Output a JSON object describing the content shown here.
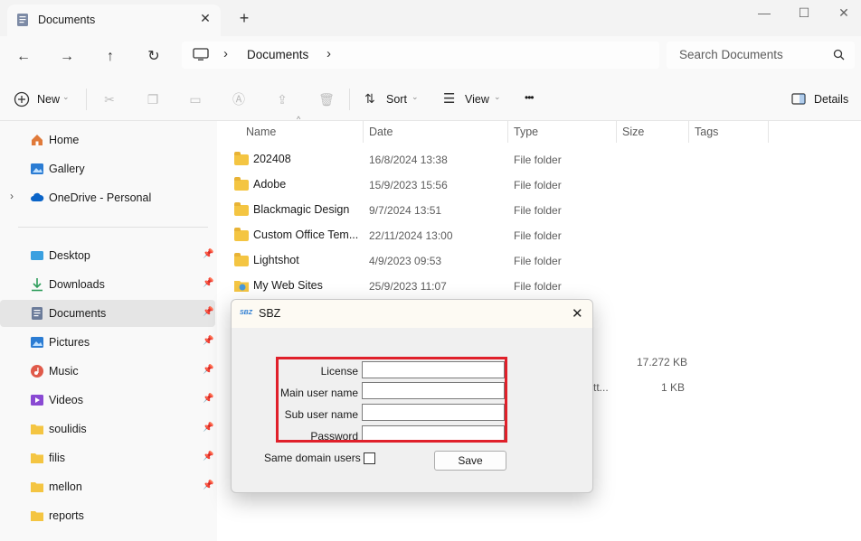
{
  "window": {
    "tab_title": "Documents",
    "tab_close": "✕",
    "new_tab": "+",
    "minimize": "—",
    "maximize": "☐",
    "close": "✕"
  },
  "nav": {
    "back": "←",
    "forward": "→",
    "up": "↑",
    "refresh": "↻",
    "breadcrumb": [
      "Documents"
    ],
    "chevron": "›",
    "search_placeholder": "Search Documents"
  },
  "toolbar": {
    "new_label": "New",
    "sort_label": "Sort",
    "view_label": "View",
    "more_label": "•••",
    "details_label": "Details"
  },
  "sidebar": {
    "top": [
      {
        "label": "Home",
        "icon": "home-icon",
        "color": "#e07a3a"
      },
      {
        "label": "Gallery",
        "icon": "gallery-icon",
        "color": "#2b7cd3"
      },
      {
        "label": "OneDrive - Personal",
        "icon": "cloud-icon",
        "color": "#0a64c8"
      }
    ],
    "pinned": [
      {
        "label": "Desktop",
        "icon": "desktop-icon",
        "color": "#3aa0e0"
      },
      {
        "label": "Downloads",
        "icon": "download-icon",
        "color": "#2e9d5b"
      },
      {
        "label": "Documents",
        "icon": "documents-icon",
        "color": "#6b7b99"
      },
      {
        "label": "Pictures",
        "icon": "pictures-icon",
        "color": "#2b7cd3"
      },
      {
        "label": "Music",
        "icon": "music-icon",
        "color": "#e05a4a"
      },
      {
        "label": "Videos",
        "icon": "videos-icon",
        "color": "#8a4ad3"
      },
      {
        "label": "soulidis",
        "icon": "folder-icon",
        "color": "#f4c542"
      },
      {
        "label": "filis",
        "icon": "folder-icon",
        "color": "#f4c542"
      },
      {
        "label": "mellon",
        "icon": "folder-icon",
        "color": "#f4c542"
      },
      {
        "label": "reports",
        "icon": "folder-icon",
        "color": "#f4c542"
      }
    ]
  },
  "columns": [
    "Name",
    "Date",
    "Type",
    "Size",
    "Tags"
  ],
  "files": [
    {
      "name": "202408",
      "date": "16/8/2024 13:38",
      "type": "File folder",
      "size": ""
    },
    {
      "name": "Adobe",
      "date": "15/9/2023 15:56",
      "type": "File folder",
      "size": ""
    },
    {
      "name": "Blackmagic Design",
      "date": "9/7/2024 13:51",
      "type": "File folder",
      "size": ""
    },
    {
      "name": "Custom Office Tem...",
      "date": "22/11/2024 13:00",
      "type": "File folder",
      "size": ""
    },
    {
      "name": "Lightshot",
      "date": "4/9/2023 09:53",
      "type": "File folder",
      "size": ""
    },
    {
      "name": "My Web Sites",
      "date": "25/9/2023 11:07",
      "type": "File folder",
      "size": ""
    }
  ],
  "hidden_rows": [
    {
      "type_partial": "",
      "size": "17.272 KB"
    },
    {
      "type_partial": "tt...",
      "size": "1 KB"
    }
  ],
  "dialog": {
    "logo": "SBZ",
    "title": "SBZ",
    "close": "✕",
    "fields": [
      {
        "label": "License",
        "value": ""
      },
      {
        "label": "Main user name",
        "value": ""
      },
      {
        "label": "Sub user name",
        "value": ""
      },
      {
        "label": "Password",
        "value": ""
      }
    ],
    "checkbox_label": "Same domain users",
    "checkbox_checked": false,
    "save_label": "Save",
    "highlight_color": "#e0202a"
  }
}
